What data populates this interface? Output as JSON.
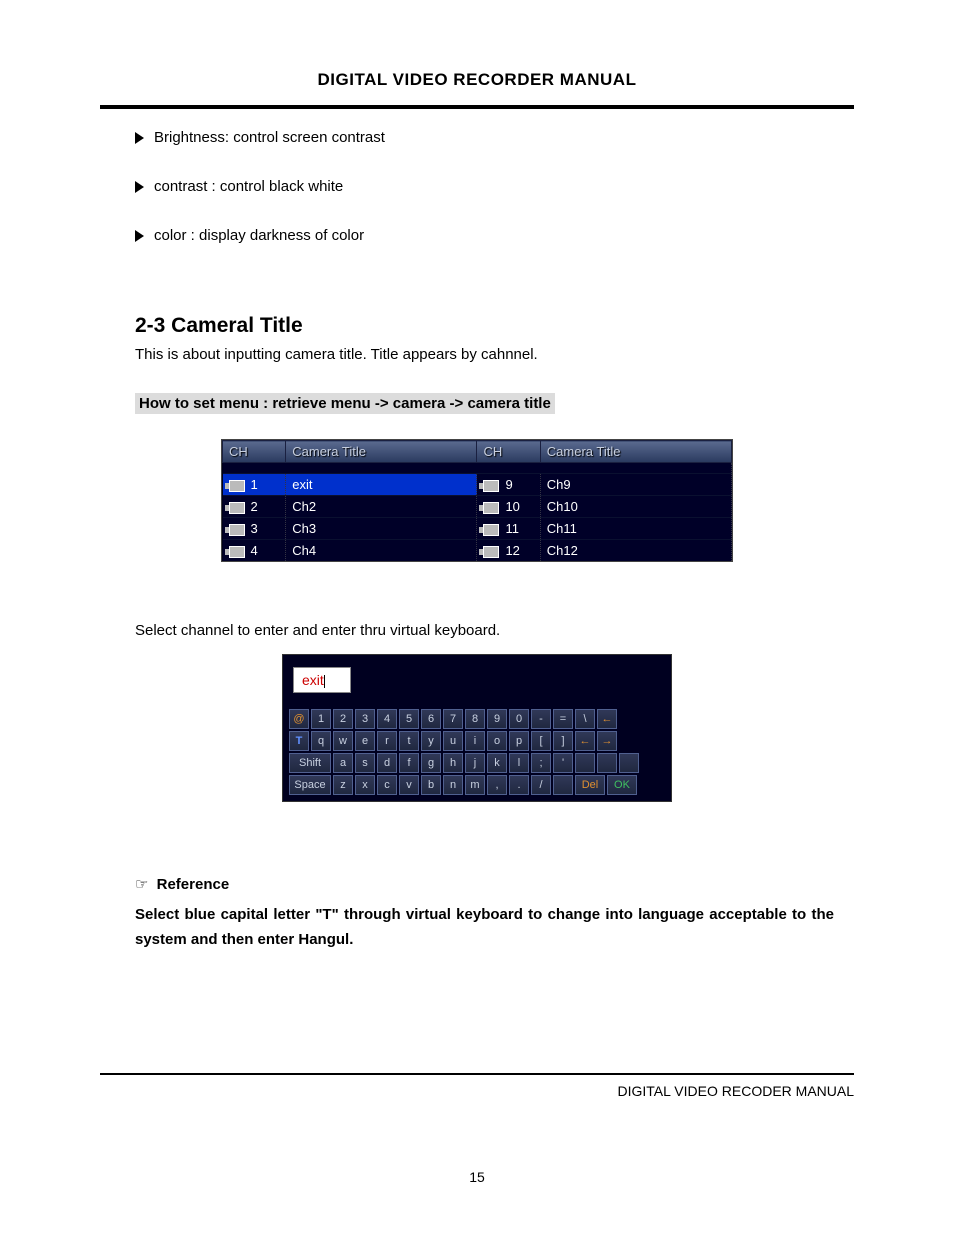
{
  "header": {
    "title": "DIGITAL VIDEO RECORDER MANUAL"
  },
  "bullets": [
    "Brightness: control screen contrast",
    "contrast : control black white",
    "color : display darkness of color"
  ],
  "section": {
    "heading": "2-3 Cameral Title",
    "intro": "This is about inputting camera title. Title appears by cahnnel.",
    "howto": "How to set menu : retrieve menu -> camera -> camera title"
  },
  "cam_table": {
    "headers": {
      "ch": "CH",
      "title": "Camera Title"
    },
    "left": [
      {
        "ch": "1",
        "title": "exit",
        "hl": true
      },
      {
        "ch": "2",
        "title": "Ch2"
      },
      {
        "ch": "3",
        "title": "Ch3"
      },
      {
        "ch": "4",
        "title": "Ch4"
      }
    ],
    "right": [
      {
        "ch": "9",
        "title": "Ch9"
      },
      {
        "ch": "10",
        "title": "Ch10"
      },
      {
        "ch": "11",
        "title": "Ch11"
      },
      {
        "ch": "12",
        "title": "Ch12"
      }
    ]
  },
  "select_text": "Select channel to enter and enter thru virtual keyboard.",
  "keyboard": {
    "input": "exit",
    "row1": [
      "@",
      "1",
      "2",
      "3",
      "4",
      "5",
      "6",
      "7",
      "8",
      "9",
      "0",
      "-",
      "=",
      "\\",
      "←"
    ],
    "row2": [
      "T",
      "q",
      "w",
      "e",
      "r",
      "t",
      "y",
      "u",
      "i",
      "o",
      "p",
      "[",
      "]",
      "←",
      "→"
    ],
    "row3": [
      "Shift",
      "a",
      "s",
      "d",
      "f",
      "g",
      "h",
      "j",
      "k",
      "l",
      ";",
      "'",
      "",
      "",
      ""
    ],
    "row4": [
      "Space",
      "z",
      "x",
      "c",
      "v",
      "b",
      "n",
      "m",
      ",",
      ".",
      "/",
      "",
      "Del",
      "OK"
    ]
  },
  "reference": {
    "label": "Reference",
    "text": "Select blue capital letter \"T\" through virtual keyboard to change into language acceptable to the system and then enter Hangul."
  },
  "footer": {
    "right": "DIGITAL VIDEO RECODER MANUAL",
    "page": "15"
  }
}
